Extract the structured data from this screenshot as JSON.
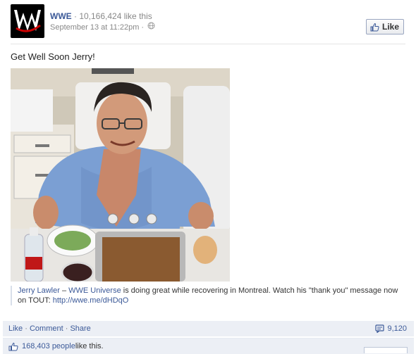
{
  "post": {
    "page_name": "WWE",
    "likes_count": "· 10,166,424 like this",
    "timestamp": "September 13 at 11:22pm ·",
    "like_button": "Like",
    "status": "Get Well Soon Jerry!",
    "caption": {
      "name": "Jerry Lawler",
      "dash": " – ",
      "group": "WWE Universe",
      "text_before": " is doing great while recovering in Montreal. Watch his \"thank you\" message now on TOUT: ",
      "url": "http://wwe.me/dHDqO"
    }
  },
  "actions": {
    "like": "Like",
    "comment": "Comment",
    "share": "Share",
    "dot": " · ",
    "shares_count": "9,120"
  },
  "likers": {
    "count": "168,403 people",
    "suffix": " like this."
  },
  "colors": {
    "link": "#3b5998",
    "bar_bg": "#eceff5"
  },
  "icons": [
    "wwe-logo",
    "globe-icon",
    "thumbs-up-icon",
    "share-icon"
  ]
}
